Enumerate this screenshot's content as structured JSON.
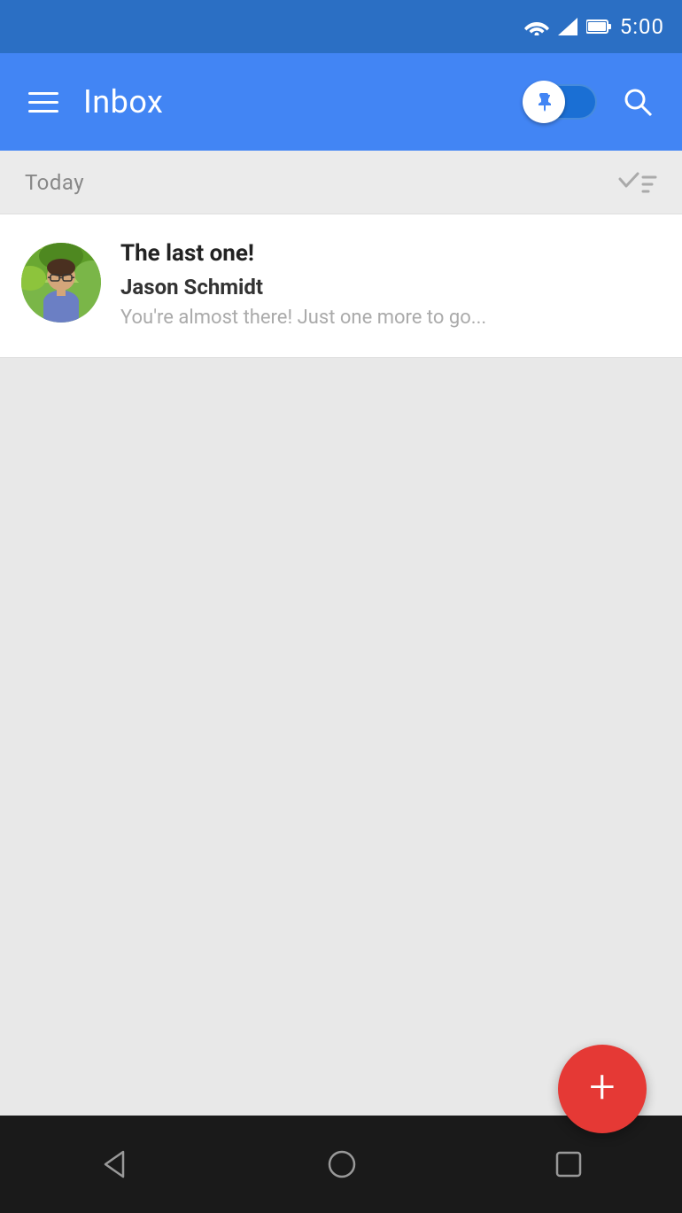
{
  "statusBar": {
    "time": "5:00"
  },
  "appBar": {
    "title": "Inbox",
    "menuAriaLabel": "Menu",
    "searchAriaLabel": "Search",
    "toggleAriaLabel": "Priority toggle"
  },
  "sectionHeader": {
    "label": "Today"
  },
  "emailItem": {
    "subject": "The last one!",
    "sender": "Jason Schmidt",
    "preview": "You're almost there! Just one more to go..."
  },
  "fab": {
    "label": "+"
  },
  "navBar": {
    "back": "◁",
    "home": "○",
    "recents": "□"
  }
}
